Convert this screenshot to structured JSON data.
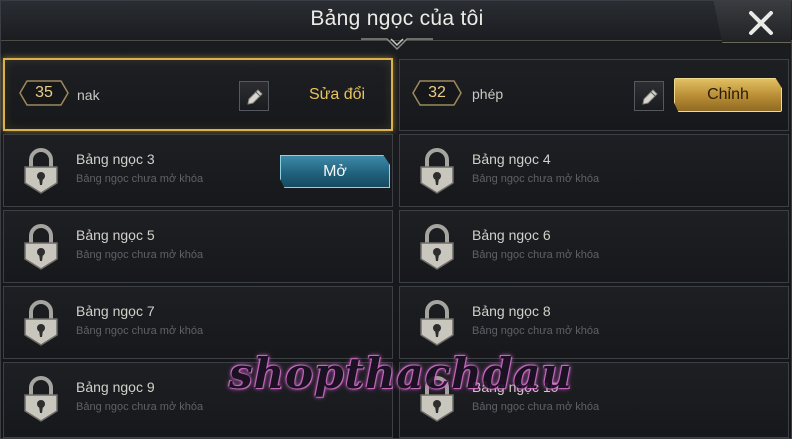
{
  "header": {
    "title": "Bảng ngọc của tôi",
    "close_icon": "close-icon"
  },
  "pages": [
    {
      "number": "35",
      "name": "nak",
      "action_label": "Sửa đổi",
      "selected": true
    },
    {
      "number": "32",
      "name": "phép",
      "action_label": "Chỉnh",
      "selected": false
    }
  ],
  "locked_slots": [
    {
      "title": "Bảng ngọc 3",
      "subtitle": "Bảng ngọc chưa mở khóa",
      "button_label": "Mở"
    },
    {
      "title": "Bảng ngọc 4",
      "subtitle": "Bảng ngọc chưa mở khóa"
    },
    {
      "title": "Bảng ngọc 5",
      "subtitle": "Bảng ngọc chưa mở khóa"
    },
    {
      "title": "Bảng ngọc 6",
      "subtitle": "Bảng ngọc chưa mở khóa"
    },
    {
      "title": "Bảng ngọc 7",
      "subtitle": "Bảng ngọc chưa mở khóa"
    },
    {
      "title": "Bảng ngọc 8",
      "subtitle": "Bảng ngọc chưa mở khóa"
    },
    {
      "title": "Bảng ngọc 9",
      "subtitle": "Bảng ngọc chưa mở khóa"
    },
    {
      "title": "Bảng ngọc 10",
      "subtitle": "Bảng ngọc chưa mở khóa"
    }
  ],
  "watermark": "shopthachdau",
  "colors": {
    "accent_gold": "#d9b24c",
    "open_blue": "#1e5f7a",
    "panel_bg": "#1b1d21"
  }
}
